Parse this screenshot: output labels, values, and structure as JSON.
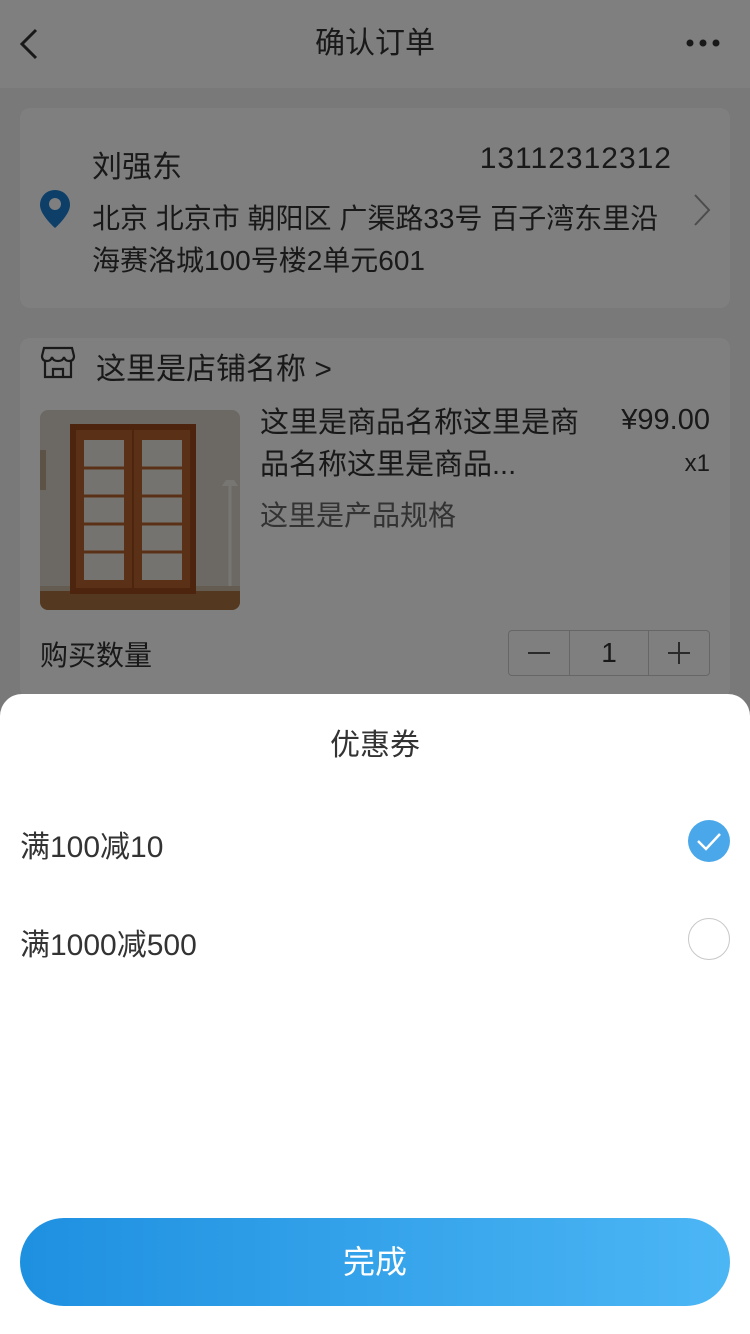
{
  "nav": {
    "title": "确认订单"
  },
  "address": {
    "name": "刘强东",
    "phone": "13112312312",
    "detail": "北京 北京市 朝阳区 广渠路33号 百子湾东里沿海赛洛城100号楼2单元601"
  },
  "shop": {
    "name": "这里是店铺名称 >"
  },
  "product": {
    "name": "这里是商品名称这里是商品名称这里是商品...",
    "price": "¥99.00",
    "quantity": "x1",
    "spec": "这里是产品规格"
  },
  "purchase": {
    "label": "购买数量",
    "count": "1"
  },
  "coupon_sheet": {
    "title": "优惠券",
    "options": [
      {
        "label": "满100减10",
        "selected": true
      },
      {
        "label": "满1000减500",
        "selected": false
      }
    ],
    "done_label": "完成"
  },
  "colors": {
    "accent": "#4aa8ea",
    "button_start": "#1e90e0",
    "button_end": "#4cb6f5",
    "location_icon": "#1a7fd0"
  }
}
